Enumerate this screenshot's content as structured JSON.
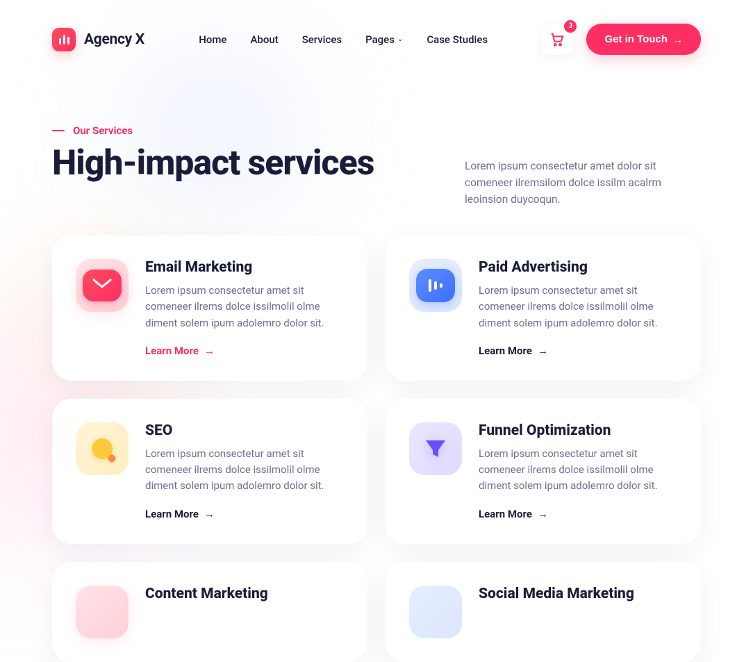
{
  "brand": {
    "name": "Agency X"
  },
  "nav": {
    "home": "Home",
    "about": "About",
    "services": "Services",
    "pages": "Pages",
    "caseStudies": "Case Studies"
  },
  "header": {
    "cartCount": "3",
    "cta": "Get in Touch"
  },
  "section": {
    "eyebrow": "Our Services",
    "title": "High-impact services",
    "lead": "Lorem ipsum consectetur amet dolor sit comeneer ilremsilom dolce issilm acalrm leoinsion duycoqun."
  },
  "cards": [
    {
      "title": "Email Marketing",
      "text": "Lorem ipsum consectetur amet sit comeneer ilrems dolce issilmolil olme diment solem ipum adolemro dolor sit.",
      "learn": "Learn More",
      "learnColor": "red",
      "iconName": "envelope-icon"
    },
    {
      "title": "Paid Advertising",
      "text": "Lorem ipsum consectetur amet sit comeneer ilrems dolce issilmolil olme diment solem ipum adolemro dolor sit.",
      "learn": "Learn More",
      "learnColor": "dark",
      "iconName": "chart-icon"
    },
    {
      "title": "SEO",
      "text": "Lorem ipsum consectetur amet sit comeneer ilrems dolce issilmolil olme diment solem ipum adolemro dolor sit.",
      "learn": "Learn More",
      "learnColor": "dark",
      "iconName": "search-icon"
    },
    {
      "title": "Funnel Optimization",
      "text": "Lorem ipsum consectetur amet sit comeneer ilrems dolce issilmolil olme diment solem ipum adolemro dolor sit.",
      "learn": "Learn More",
      "learnColor": "dark",
      "iconName": "funnel-icon"
    },
    {
      "title": "Content Marketing",
      "text": "",
      "learn": "",
      "learnColor": "dark",
      "iconName": "content-icon"
    },
    {
      "title": "Social Media Marketing",
      "text": "",
      "learn": "",
      "learnColor": "dark",
      "iconName": "social-icon"
    }
  ]
}
